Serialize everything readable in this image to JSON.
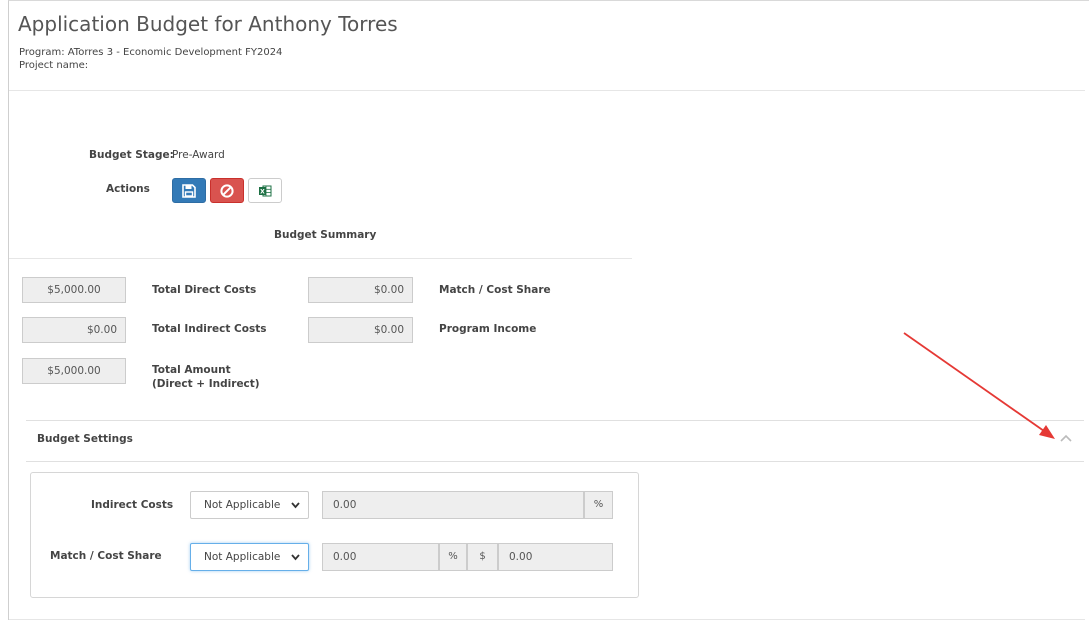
{
  "page": {
    "title": "Application Budget for Anthony Torres",
    "program": "Program: ATorres 3 - Economic Development FY2024",
    "project": "Project name:"
  },
  "stage": {
    "label": "Budget Stage:",
    "value": "Pre-Award"
  },
  "actions": {
    "label": "Actions",
    "buttons": [
      {
        "name": "save",
        "icon": "save-icon",
        "color": "#337ab7"
      },
      {
        "name": "cancel",
        "icon": "ban-icon",
        "color": "#d9534f"
      },
      {
        "name": "export",
        "icon": "excel-icon",
        "color": "#1d7044"
      }
    ]
  },
  "summary": {
    "heading": "Budget Summary",
    "total_direct": {
      "value": "$5,000.00",
      "label": "Total Direct Costs"
    },
    "total_indirect": {
      "value": "$0.00",
      "label": "Total Indirect Costs"
    },
    "total_amount": {
      "value": "$5,000.00",
      "label_line1": "Total Amount",
      "label_line2": "(Direct + Indirect)"
    },
    "match_cost_share": {
      "value": "$0.00",
      "label": "Match / Cost Share"
    },
    "program_income": {
      "value": "$0.00",
      "label": "Program Income"
    }
  },
  "settings": {
    "heading": "Budget Settings",
    "indirect": {
      "label": "Indirect Costs",
      "select": "Not Applicable",
      "value": "0.00",
      "percent": "%"
    },
    "match": {
      "label": "Match / Cost Share",
      "select": "Not Applicable",
      "value": "0.00",
      "percent": "%",
      "dollar": "$",
      "amount": "0.00"
    }
  },
  "colors": {
    "annotation_arrow": "#e53935",
    "focus": "#66afe9"
  }
}
